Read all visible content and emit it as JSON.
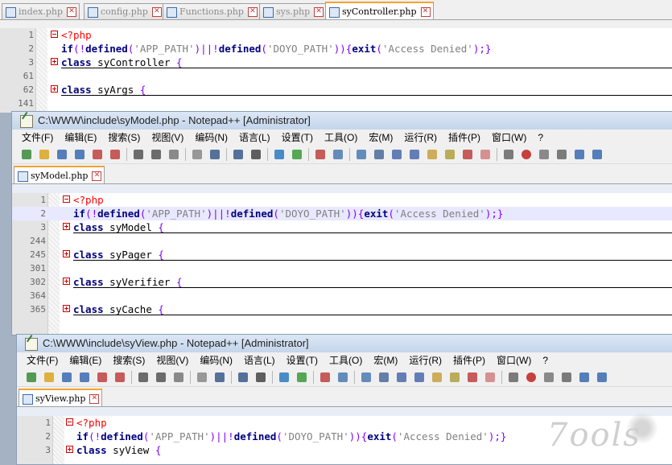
{
  "colors": {
    "keyword": "#000080",
    "string": "#808080",
    "operator": "#8000ff",
    "php_tag": "#ff0000",
    "active_tab_accent": "#f4a430",
    "tab_close": "#c24040"
  },
  "window1": {
    "tabs": [
      {
        "label": "index.php",
        "active": false
      },
      {
        "label": "config.php",
        "active": false
      },
      {
        "label": "Functions.php",
        "active": false
      },
      {
        "label": "sys.php",
        "active": false
      },
      {
        "label": "syController.php",
        "active": true
      }
    ],
    "lines": [
      {
        "num": "1",
        "fold": "minus",
        "tokens": [
          {
            "t": "<?php",
            "c": "php"
          }
        ]
      },
      {
        "num": "2",
        "fold": "",
        "tokens": [
          {
            "t": "if",
            "c": "kw"
          },
          {
            "t": "(!",
            "c": "op"
          },
          {
            "t": "defined",
            "c": "kw"
          },
          {
            "t": "(",
            "c": "op"
          },
          {
            "t": "'APP_PATH'",
            "c": "str"
          },
          {
            "t": ")||!",
            "c": "op"
          },
          {
            "t": "defined",
            "c": "kw"
          },
          {
            "t": "(",
            "c": "op"
          },
          {
            "t": "'DOYO_PATH'",
            "c": "str"
          },
          {
            "t": ")){",
            "c": "op"
          },
          {
            "t": "exit",
            "c": "kw"
          },
          {
            "t": "(",
            "c": "op"
          },
          {
            "t": "'Access Denied'",
            "c": "str"
          },
          {
            "t": ");}",
            "c": "op"
          }
        ]
      },
      {
        "num": "3",
        "fold": "plus",
        "collapsed": true,
        "tokens": [
          {
            "t": "class",
            "c": "kw"
          },
          {
            "t": " syController ",
            "c": "plain"
          },
          {
            "t": "{",
            "c": "op"
          }
        ]
      },
      {
        "num": "61",
        "fold": "",
        "tokens": []
      },
      {
        "num": "62",
        "fold": "plus",
        "collapsed": true,
        "tokens": [
          {
            "t": "class",
            "c": "kw"
          },
          {
            "t": " syArgs ",
            "c": "plain"
          },
          {
            "t": "{",
            "c": "op"
          }
        ]
      },
      {
        "num": "141",
        "fold": "",
        "tokens": []
      }
    ]
  },
  "window2": {
    "title": "C:\\WWW\\include\\syModel.php - Notepad++ [Administrator]",
    "menu": [
      "文件(F)",
      "编辑(E)",
      "搜索(S)",
      "视图(V)",
      "编码(N)",
      "语言(L)",
      "设置(T)",
      "工具(O)",
      "宏(M)",
      "运行(R)",
      "插件(P)",
      "窗口(W)",
      "?"
    ],
    "tabs": [
      {
        "label": "syModel.php",
        "active": true
      }
    ],
    "lines": [
      {
        "num": "1",
        "fold": "minus",
        "tokens": [
          {
            "t": "<?php",
            "c": "php"
          }
        ]
      },
      {
        "num": "2",
        "fold": "",
        "highlight": true,
        "tokens": [
          {
            "t": "if",
            "c": "kw"
          },
          {
            "t": "(!",
            "c": "op"
          },
          {
            "t": "defined",
            "c": "kw"
          },
          {
            "t": "(",
            "c": "op"
          },
          {
            "t": "'APP_PATH'",
            "c": "str"
          },
          {
            "t": ")||!",
            "c": "op"
          },
          {
            "t": "defined",
            "c": "kw"
          },
          {
            "t": "(",
            "c": "op"
          },
          {
            "t": "'DOYO_PATH'",
            "c": "str"
          },
          {
            "t": ")){",
            "c": "op"
          },
          {
            "t": "exit",
            "c": "kw"
          },
          {
            "t": "(",
            "c": "op"
          },
          {
            "t": "'Access Denied'",
            "c": "str"
          },
          {
            "t": ");}",
            "c": "op"
          }
        ]
      },
      {
        "num": "3",
        "fold": "plus",
        "collapsed": true,
        "tokens": [
          {
            "t": "class",
            "c": "kw"
          },
          {
            "t": " syModel ",
            "c": "plain"
          },
          {
            "t": "{",
            "c": "op"
          }
        ]
      },
      {
        "num": "244",
        "fold": "",
        "tokens": []
      },
      {
        "num": "245",
        "fold": "plus",
        "collapsed": true,
        "tokens": [
          {
            "t": "class",
            "c": "kw"
          },
          {
            "t": " syPager ",
            "c": "plain"
          },
          {
            "t": "{",
            "c": "op"
          }
        ]
      },
      {
        "num": "301",
        "fold": "",
        "tokens": []
      },
      {
        "num": "302",
        "fold": "plus",
        "collapsed": true,
        "tokens": [
          {
            "t": "class",
            "c": "kw"
          },
          {
            "t": " syVerifier ",
            "c": "plain"
          },
          {
            "t": "{",
            "c": "op"
          }
        ]
      },
      {
        "num": "364",
        "fold": "",
        "tokens": []
      },
      {
        "num": "365",
        "fold": "plus",
        "collapsed": true,
        "tokens": [
          {
            "t": "class",
            "c": "kw"
          },
          {
            "t": " syCache ",
            "c": "plain"
          },
          {
            "t": "{",
            "c": "op"
          }
        ]
      }
    ]
  },
  "window3": {
    "title": "C:\\WWW\\include\\syView.php - Notepad++ [Administrator]",
    "menu": [
      "文件(F)",
      "编辑(E)",
      "搜索(S)",
      "视图(V)",
      "编码(N)",
      "语言(L)",
      "设置(T)",
      "工具(O)",
      "宏(M)",
      "运行(R)",
      "插件(P)",
      "窗口(W)",
      "?"
    ],
    "tabs": [
      {
        "label": "syView.php",
        "active": true
      }
    ],
    "lines": [
      {
        "num": "1",
        "fold": "minus",
        "tokens": [
          {
            "t": "<?php",
            "c": "php"
          }
        ]
      },
      {
        "num": "2",
        "fold": "",
        "tokens": [
          {
            "t": "if",
            "c": "kw"
          },
          {
            "t": "(!",
            "c": "op"
          },
          {
            "t": "defined",
            "c": "kw"
          },
          {
            "t": "(",
            "c": "op"
          },
          {
            "t": "'APP_PATH'",
            "c": "str"
          },
          {
            "t": ")||!",
            "c": "op"
          },
          {
            "t": "defined",
            "c": "kw"
          },
          {
            "t": "(",
            "c": "op"
          },
          {
            "t": "'DOYO_PATH'",
            "c": "str"
          },
          {
            "t": ")){",
            "c": "op"
          },
          {
            "t": "exit",
            "c": "kw"
          },
          {
            "t": "(",
            "c": "op"
          },
          {
            "t": "'Access Denied'",
            "c": "str"
          },
          {
            "t": ");}",
            "c": "op"
          }
        ]
      },
      {
        "num": "3",
        "fold": "plus",
        "tokens": [
          {
            "t": "class",
            "c": "kw"
          },
          {
            "t": " syView ",
            "c": "plain"
          },
          {
            "t": "{",
            "c": "op"
          }
        ]
      }
    ]
  },
  "toolbar_icons": [
    "new-file-icon",
    "open-file-icon",
    "save-icon",
    "save-all-icon",
    "close-icon",
    "close-all-icon",
    "print-icon",
    "cut-icon",
    "copy-icon",
    "paste-icon",
    "undo-icon",
    "redo-icon",
    "find-icon",
    "replace-icon",
    "zoom-in-icon",
    "zoom-out-icon",
    "sync-vertical-icon",
    "sync-horizontal-icon",
    "word-wrap-icon",
    "show-all-chars-icon",
    "indent-guide-icon",
    "user-lang-icon",
    "doc-map-icon",
    "function-list-icon",
    "folder-workspace-icon",
    "monitor-icon",
    "record-macro-icon",
    "stop-record-icon",
    "play-macro-icon",
    "run-macro-multiple-icon",
    "save-macro-icon"
  ],
  "watermark": "7ools"
}
